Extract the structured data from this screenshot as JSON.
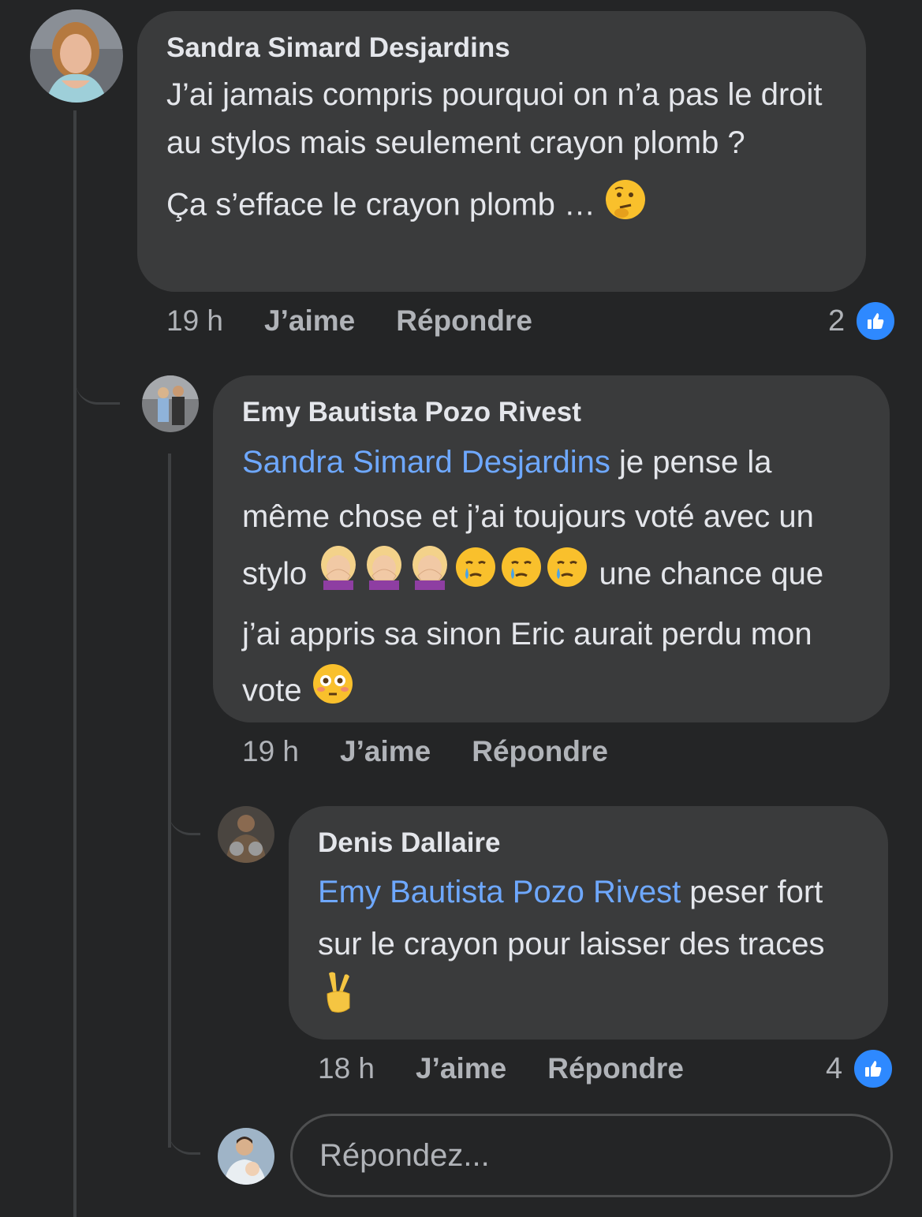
{
  "colors": {
    "background": "#242526",
    "bubble": "#3a3b3c",
    "mention": "#6ea8ff",
    "like": "#2e89ff",
    "muted": "#b0b3b8"
  },
  "comments": [
    {
      "author": "Sandra Simard Desjardins",
      "text_p1": "J’ai jamais compris pourquoi on n’a pas le droit au stylos mais seulement crayon plomb ?",
      "text_p2": "Ça s’efface le crayon plomb …",
      "emoji": "thinking-face",
      "time": "19 h",
      "like_label": "J’aime",
      "reply_label": "Répondre",
      "reaction_count": "2"
    },
    {
      "author": "Emy Bautista Pozo Rivest",
      "mention": "Sandra Simard Desjardins",
      "text_a": " je pense la même chose et j’ai toujours voté avec un stylo ",
      "text_b": " une chance que j’ai appris sa sinon Eric aurait perdu mon vote ",
      "emojis": [
        "face-palm",
        "face-palm",
        "face-palm",
        "crying-face",
        "crying-face",
        "crying-face",
        "flushed-face"
      ],
      "time": "19 h",
      "like_label": "J’aime",
      "reply_label": "Répondre"
    },
    {
      "author": "Denis Dallaire",
      "mention": "Emy Bautista Pozo Rivest",
      "text": " peser fort sur le crayon pour laisser des traces ",
      "emoji": "victory-hand",
      "time": "18 h",
      "like_label": "J’aime",
      "reply_label": "Répondre",
      "reaction_count": "4"
    }
  ],
  "reply_box": {
    "placeholder": "Répondez..."
  }
}
